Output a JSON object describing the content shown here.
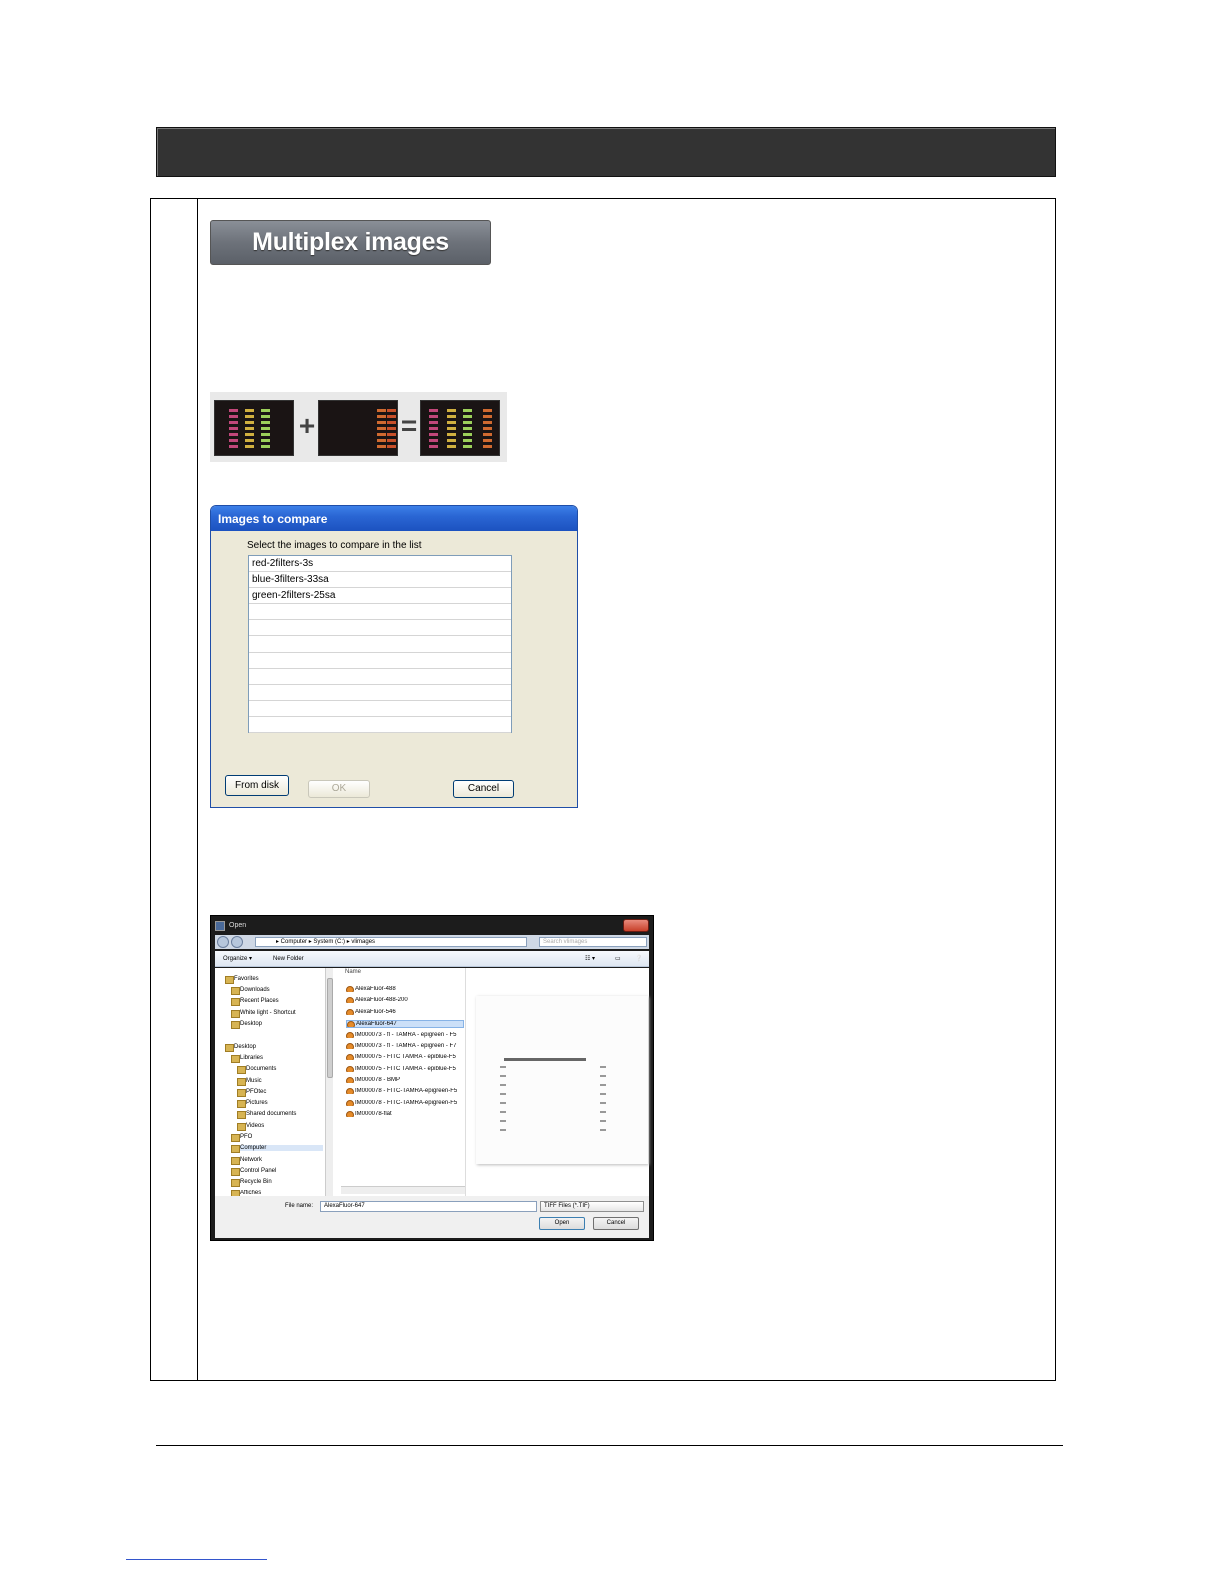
{
  "multiplex_button": {
    "label": "Multiplex images"
  },
  "combo_strip": {
    "plus": "+",
    "equals": "="
  },
  "compare_dialog": {
    "title": "Images to compare",
    "prompt": "Select the images to compare in the list",
    "items": [
      "red-2filters-3s",
      "blue-3filters-33sa",
      "green-2filters-25sa",
      "",
      "",
      "",
      "",
      "",
      "",
      "",
      ""
    ],
    "buttons": {
      "from_disk": "From disk",
      "ok": "OK",
      "cancel": "Cancel"
    }
  },
  "open_dialog": {
    "title": "Open",
    "address_path": "▸ Computer ▸ System (C:) ▸ vlimages",
    "search_placeholder": "Search vlimages",
    "toolbar": {
      "organize": "Organize ▾",
      "new_folder": "New Folder"
    },
    "nav": {
      "favorites": "Favorites",
      "downloads": "Downloads",
      "recent_places": "Recent Places",
      "white_light": "White light - Shortcut",
      "desktop_fav": "Desktop",
      "desktop": "Desktop",
      "libraries": "Libraries",
      "documents": "Documents",
      "music": "Music",
      "pfotec": "PFOtec",
      "pictures": "Pictures",
      "shared_documents": "Shared documents",
      "videos": "Videos",
      "pfo": "PFO",
      "computer": "Computer",
      "network": "Network",
      "control_panel": "Control Panel",
      "recycle_bin": "Recycle Bin",
      "affiches": "Affiches"
    },
    "file_column_header": "Name",
    "files": [
      "AlexaFluor-488",
      "AlexaFluor-488-200",
      "AlexaFluor-546",
      "AlexaFluor-647",
      "IM000073 - fl - TAMRA - epigreen - F5",
      "IM000073 - fl - TAMRA - epigreen - F7",
      "IM000075 - FITC TAMRA - epiblue-F5",
      "IM000075 - FITC TAMRA - epiblue-F5",
      "IM000078 - BMP",
      "IM000078 - FITC-TAMRA-epigreen-F5",
      "IM000078 - FITC-TAMRA-epigreen-F5",
      "IM000078-flat"
    ],
    "selected_file_index": 3,
    "file_name_label": "File name:",
    "file_name_value": "AlexaFluor-647",
    "file_type": "TIFF Files (*.TIF)",
    "open_button": "Open",
    "cancel_button": "Cancel"
  }
}
